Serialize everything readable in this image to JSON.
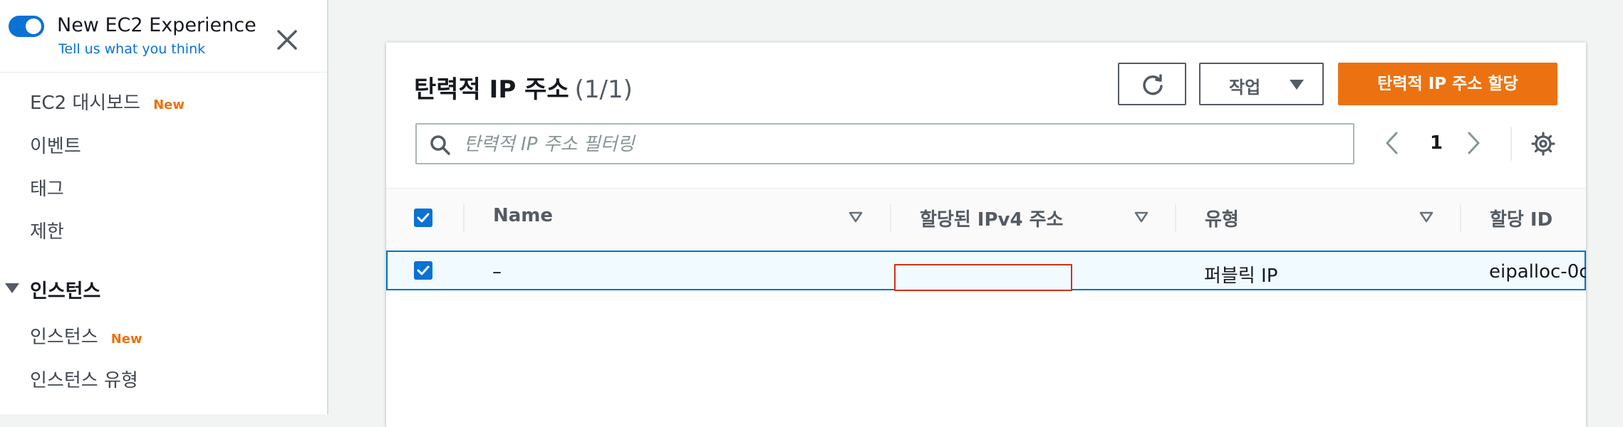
{
  "sidebar": {
    "experience_title": "New EC2 Experience",
    "experience_link": "Tell us what you think",
    "items": [
      {
        "label": "EC2 대시보드",
        "badge": "New"
      },
      {
        "label": "이벤트"
      },
      {
        "label": "태그"
      },
      {
        "label": "제한"
      }
    ],
    "section": "인스턴스",
    "section_items": [
      {
        "label": "인스턴스",
        "badge": "New"
      },
      {
        "label": "인스턴스 유형"
      }
    ]
  },
  "panel": {
    "title": "탄력적 IP 주소",
    "count": "(1/1)",
    "actions_label": "작업",
    "primary_label": "탄력적 IP 주소 할당",
    "search_placeholder": "탄력적 IP 주소 필터링",
    "page": "1"
  },
  "table": {
    "columns": [
      "Name",
      "할당된 IPv4 주소",
      "유형",
      "할당 ID"
    ],
    "rows": [
      {
        "name": "–",
        "ipv4": "",
        "type": "퍼블릭 IP",
        "allocation_id": "eipalloc-0c"
      }
    ]
  },
  "colors": {
    "accent": "#0972d3",
    "primary": "#ec7211",
    "selected_row": "#f1faff"
  }
}
